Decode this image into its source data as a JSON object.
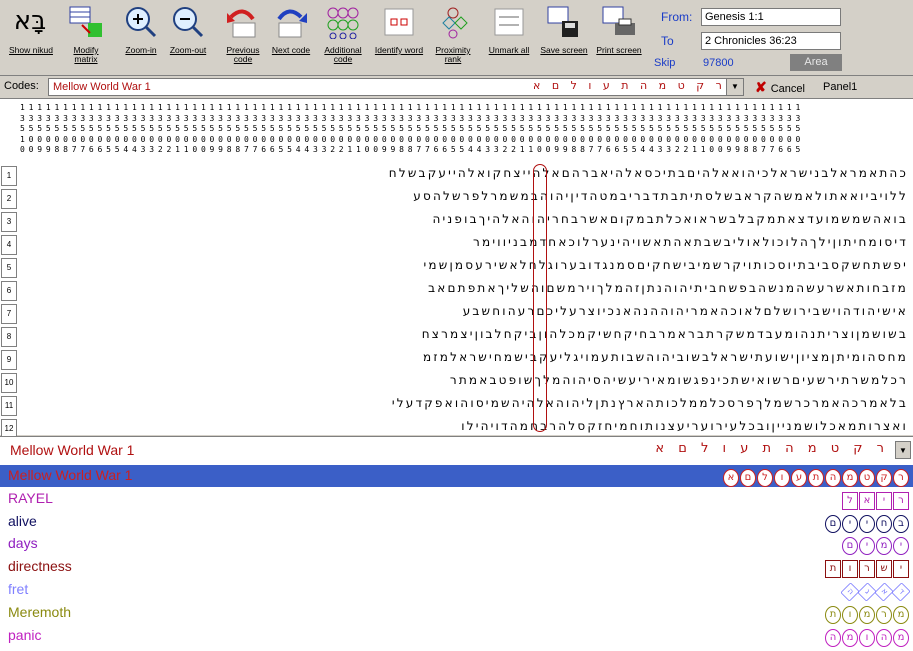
{
  "toolbar": {
    "buttons": [
      {
        "label": "Show nikud",
        "icon": "hebrew-letters-icon"
      },
      {
        "label": "Modify matrix",
        "icon": "matrix-grid-icon"
      },
      {
        "label": "Zoom-in",
        "icon": "zoom-in-icon"
      },
      {
        "label": "Zoom-out",
        "icon": "zoom-out-icon"
      },
      {
        "label": "Previous code",
        "icon": "previous-code-icon"
      },
      {
        "label": "Next code",
        "icon": "next-code-icon"
      },
      {
        "label": "Additional code",
        "icon": "additional-code-icon"
      },
      {
        "label": "Identify word",
        "icon": "identify-word-icon"
      },
      {
        "label": "Proximity rank",
        "icon": "proximity-rank-icon"
      },
      {
        "label": "Unmark all",
        "icon": "unmark-all-icon"
      },
      {
        "label": "Save screen",
        "icon": "save-screen-icon"
      },
      {
        "label": "Print screen",
        "icon": "print-screen-icon"
      }
    ],
    "logo_text": "בָּא"
  },
  "range": {
    "from_label": "From:",
    "from_value": "Genesis 1:1",
    "to_label": "To",
    "to_value": "2 Chronicles 36:23",
    "skip_label": "Skip",
    "skip_value": "97800",
    "area_label": "Area"
  },
  "codes": {
    "label": "Codes:",
    "value": "Mellow World War 1",
    "letters": "ר ק ט מ ה ת ע ו ל ם א",
    "cancel_label": "Cancel",
    "panel_label": "Panel1"
  },
  "ruler": {
    "rows": [
      "1111111111111111111111111111111111111111111111111111111111111111111111111111111111111111111",
      "3333333333333333333333333333333333333333333333333333333333333333333333333333333333333333333",
      "5555555555555555555555555555555555555555555555555555555555555555555555555555555555555555555",
      "1000000000000000000000000000000000000000000000000000000000000000000000000000000000000000000",
      "0099887766554433221100998877665544332211009988776655443322110099887766554433221100998877665"
    ]
  },
  "grid": {
    "row_numbers": [
      "1",
      "2",
      "3",
      "4",
      "5",
      "6",
      "7",
      "8",
      "9",
      "10",
      "11",
      "12"
    ],
    "lines": [
      "כהתאמראלבנישראלכיהואאלהיםבתיכסאלהיאברהםאלהייצחקואלהייעקבשלח",
      "ללויביואאתולאמשהקראבשלסתיתבתדבריבמטהדיןיהוהבמשמרלפרשלהסע",
      "בואהשמשמועדצאתמקבלבשראואכלתבמקוםאשרבחריהוהאלהיךבופניה",
      "דיסומחיתוןילךהלוכולאוליבשבתאהתאשויהינערלוכאחדמבניווימר",
      "יפשתחשקסביבתיוסכותויקרשמיבישחקיםסמנגדובערוגלחלאשירעסמןשמי",
      "מזבחותאשרעשהמנשהבפשחביתיהוהנתןזהמלךוירמשםוהשליךאתפתםאב",
      "אישיהודהוישבירושלםלאוכהאמריהוההנהאנכיוצרעליכםרעהוחשבע",
      "בשושמןוצריתנהומעבדמשקרתבראמרבחיקחשיקמכלהוןביקחלבוןיצמרצח",
      "מחסהומיתןמציוןישועתישראלבשוביהוהשבותעמויגליעקבישמחישראלמזמ",
      "רכלמשרתירשעיםרשואישתכינפגשומאיריעשיהסיהוהמלךשופטבאמתר",
      "בלאמרכהאמרכרשמלךפרסכלממלכותהארץנתןליהוהאלהיהשמיסוהואפקדעלי",
      "ואצרותמאכלושמנייןובכלעירועריעצנותוחמיחזקסלהרבחמהדויהילו"
    ]
  },
  "term_bar": {
    "value": "Mellow World War 1",
    "letters": "ר ק ט מ ה ת ע ו ל ם א"
  },
  "results": [
    {
      "term": "Mellow World War 1",
      "color": "#cc2020",
      "glyphs": "רקטמהתעולםא",
      "style": "circle"
    },
    {
      "term": "RAYEL",
      "color": "#b020b0",
      "glyphs": "ריאל",
      "style": "square"
    },
    {
      "term": "alive",
      "color": "#101060",
      "glyphs": "בחיים",
      "style": "circle"
    },
    {
      "term": "days",
      "color": "#9020c0",
      "glyphs": "ימים",
      "style": "circle"
    },
    {
      "term": "directness",
      "color": "#8b1010",
      "glyphs": "ישרות",
      "style": "square"
    },
    {
      "term": "fret",
      "color": "#8080ff",
      "glyphs": "דאגה",
      "style": "diamond"
    },
    {
      "term": "Meremoth",
      "color": "#8a8a10",
      "glyphs": "מרמות",
      "style": "circle"
    },
    {
      "term": "panic",
      "color": "#c020c0",
      "glyphs": "מהומה",
      "style": "circle"
    }
  ]
}
